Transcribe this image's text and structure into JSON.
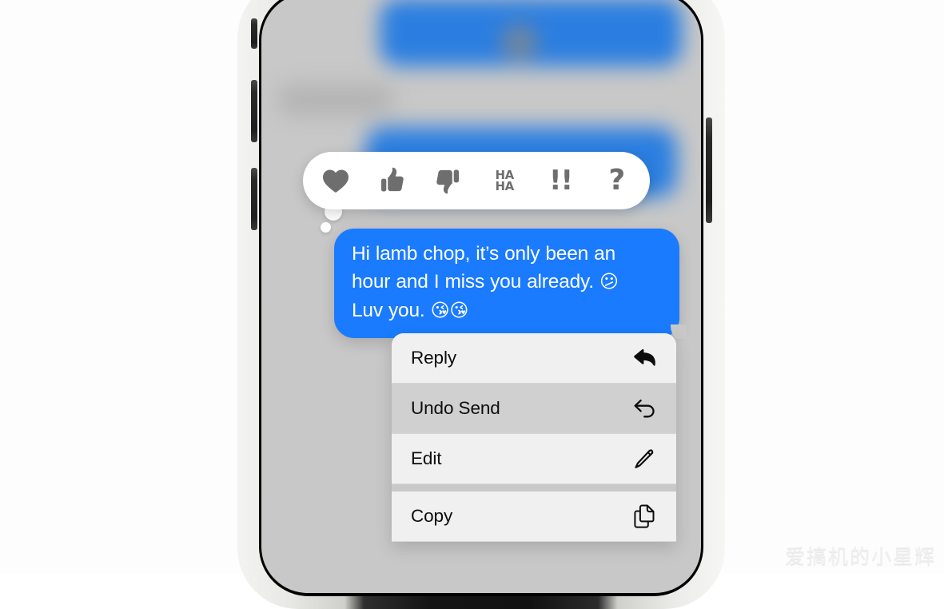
{
  "device": {
    "name": "iphone",
    "buttons": [
      {
        "name": "silent-switch",
        "label": "Silent switch"
      },
      {
        "name": "volume-up-button",
        "label": "Volume up"
      },
      {
        "name": "volume-down-button",
        "label": "Volume down"
      },
      {
        "name": "side-power-button",
        "label": "Side button"
      }
    ],
    "frame_color": "#121212",
    "rail_color": "#e9e9e6"
  },
  "screen": {
    "app": "Messages",
    "dimmed_background_color": "#c8c8c8",
    "bubble_blue": "#1a7bff",
    "menu_background": "#f0f0f0",
    "menu_highlight": "#d0d0d0"
  },
  "background_messages": [
    {
      "name": "blurred-sent-bubble-1",
      "type": "sent",
      "blurred": true
    },
    {
      "name": "blurred-received-bubble",
      "type": "received",
      "blurred": true
    },
    {
      "name": "blurred-sent-bubble-2",
      "type": "sent",
      "blurred": true
    }
  ],
  "tapback_bar": {
    "name": "tapback-reaction-bar",
    "options": [
      {
        "name": "heart-icon",
        "label": "Love",
        "glyph": "heart"
      },
      {
        "name": "thumbs-up-icon",
        "label": "Like",
        "glyph": "thumbs-up"
      },
      {
        "name": "thumbs-down-icon",
        "label": "Dislike",
        "glyph": "thumbs-down"
      },
      {
        "name": "haha-icon",
        "label": "Haha",
        "glyph": "HA\nHA",
        "line1": "HA",
        "line2": "HA"
      },
      {
        "name": "exclamation-icon",
        "label": "Emphasize",
        "glyph": "!!"
      },
      {
        "name": "question-icon",
        "label": "Question",
        "glyph": "?"
      }
    ]
  },
  "focused_message": {
    "name": "focused-message-bubble",
    "type": "sent",
    "line1": "Hi lamb chop, it’s only been an",
    "line2": "hour and I miss you already.",
    "emoji_1": "😕",
    "line3": "Luv you.",
    "emoji_2": "😘",
    "emoji_3": "😘",
    "full_text": "Hi lamb chop, it’s only been an hour and I miss you already. 😕 Luv you. 😘😘"
  },
  "context_menu": {
    "name": "message-context-menu",
    "items": [
      {
        "label": "Reply",
        "icon": "reply-arrow-icon",
        "highlighted": false
      },
      {
        "label": "Undo Send",
        "icon": "undo-arrow-icon",
        "highlighted": true
      },
      {
        "label": "Edit",
        "icon": "pencil-icon",
        "highlighted": false
      },
      {
        "label": "Copy",
        "icon": "copy-documents-icon",
        "highlighted": false
      }
    ]
  },
  "watermark": {
    "text": "爱搞机的小星辉"
  }
}
